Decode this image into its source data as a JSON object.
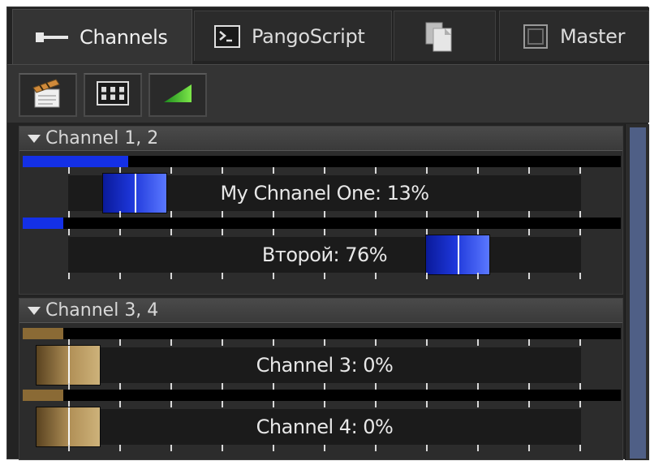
{
  "tabs": [
    {
      "label": "Channels",
      "icon": "channels-icon",
      "active": true
    },
    {
      "label": "PangoScript",
      "icon": "script-icon",
      "active": false
    },
    {
      "label": "",
      "icon": "pages-icon",
      "active": false
    },
    {
      "label": "Master",
      "icon": "master-icon",
      "active": false
    }
  ],
  "toolbar": {
    "buttons": [
      {
        "icon": "clapperboard-icon"
      },
      {
        "icon": "channel-grid-icon"
      },
      {
        "icon": "volume-ramp-icon"
      }
    ]
  },
  "groups": [
    {
      "title": "Channel 1, 2",
      "channels": [
        {
          "label": "My Chnanel One: 13%",
          "level": 0.13,
          "color": "#1430e6"
        },
        {
          "label": "Второй: 76%",
          "level": 0.76,
          "color": "#1430e6"
        }
      ]
    },
    {
      "title": "Channel 3, 4",
      "channels": [
        {
          "label": "Channel 3: 0%",
          "level": 0.0,
          "color": "#8a6a35"
        },
        {
          "label": "Channel 4: 0%",
          "level": 0.0,
          "color": "#8a6a35"
        }
      ]
    }
  ],
  "colors": {
    "scrollbar_thumb": "#4f5f86",
    "blue_knob": "#1d36d9",
    "gold_knob": "#b39259"
  }
}
